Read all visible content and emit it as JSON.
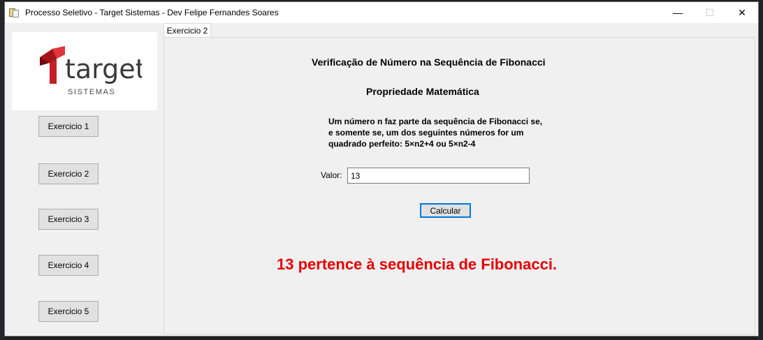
{
  "window": {
    "title": "Processo Seletivo - Target Sistemas - Dev Felipe Fernandes Soares",
    "controls": {
      "minimize": "—",
      "maximize": "☐",
      "close": "✕"
    }
  },
  "logo": {
    "text": "target",
    "subtext": "SISTEMAS",
    "color": "#c41e24"
  },
  "sidebar": {
    "buttons": [
      "Exercicio 1",
      "Exercicio 2",
      "Exercicio 3",
      "Exercicio 4",
      "Exercicio 5"
    ]
  },
  "tabs": [
    {
      "label": "Exercicio 2",
      "active": true
    }
  ],
  "main": {
    "title": "Verificação de Número na Sequência de Fibonacci",
    "subtitle": "Propriedade Matemática",
    "description": [
      "Um número n faz parte da sequência de Fibonacci se,",
      "e somente se, um dos seguintes números for um",
      "quadrado perfeito: 5×n2+4 ou 5×n2-4"
    ],
    "valor_label": "Valor:",
    "valor_value": "13",
    "calc_label": "Calcular",
    "result": "13 pertence à sequência de Fibonacci.",
    "result_color": "#e60000"
  }
}
